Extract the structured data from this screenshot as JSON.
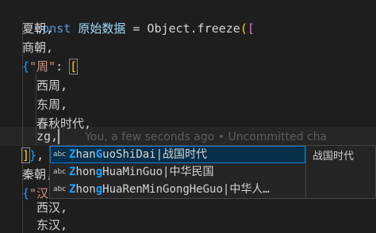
{
  "code": {
    "line1": {
      "kw": "const",
      "name": "原始数据",
      "eq": "=",
      "call": "Object.freeze",
      "paren": "(",
      "open": "["
    },
    "line2": "夏朝,",
    "line3": "商朝,",
    "line4": {
      "brace": "{",
      "key": "\"周\"",
      "colon": ":",
      "open": "["
    },
    "line5": "西周,",
    "line6": "东周,",
    "line7": "春秋时代,",
    "line8": "zg,",
    "line9": {
      "close_bracket": "]",
      "close_brace": "}",
      "comma": ","
    },
    "line10": "秦朝,",
    "line11": {
      "brace": "{",
      "key": "\"汉\""
    },
    "line12": "西汉,",
    "line13": "东汉,"
  },
  "blame": "You, a few seconds ago • Uncommitted cha",
  "suggest": {
    "items": [
      {
        "kind": "abc",
        "m1": "Z",
        "t1": "han",
        "m2": "G",
        "t2": "uoShiDai|战国时代"
      },
      {
        "kind": "abc",
        "m1": "Z",
        "t1": "hon",
        "m2": "g",
        "t2": "HuaMinGuo|中华民国"
      },
      {
        "kind": "abc",
        "m1": "Z",
        "t1": "hon",
        "m2": "g",
        "t2": "HuaRenMinGongHeGuo|中华人…"
      }
    ],
    "detail": "战国时代"
  }
}
